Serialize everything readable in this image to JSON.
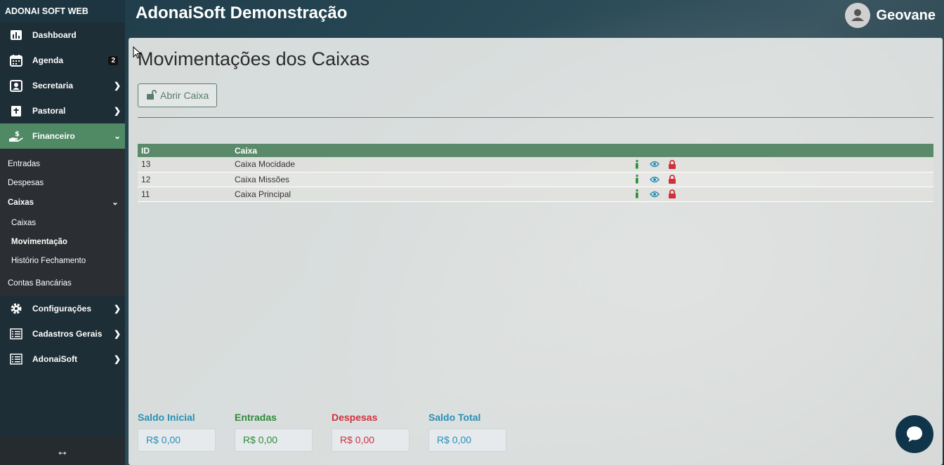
{
  "app": {
    "brand": "ADONAI SOFT WEB",
    "title": "AdonaiSoft Demonstração"
  },
  "user": {
    "name": "Geovane"
  },
  "sidebar": {
    "items": [
      {
        "label": "Dashboard",
        "icon": "bar-chart-icon"
      },
      {
        "label": "Agenda",
        "icon": "calendar-icon",
        "badge": "2"
      },
      {
        "label": "Secretaria",
        "icon": "id-card-icon"
      },
      {
        "label": "Pastoral",
        "icon": "bible-icon"
      },
      {
        "label": "Financeiro",
        "icon": "hand-money-icon"
      }
    ],
    "financeiro_sub": {
      "entradas": "Entradas",
      "despesas": "Despesas",
      "caixas": "Caixas",
      "caixas_sub": [
        "Caixas",
        "Movimentação",
        "Histório Fechamento"
      ],
      "contas": "Contas Bancárias"
    },
    "bottom_items": [
      {
        "label": "Configurações",
        "icon": "gear-icon"
      },
      {
        "label": "Cadastros Gerais",
        "icon": "list-icon"
      },
      {
        "label": "AdonaiSoft",
        "icon": "list-icon"
      }
    ],
    "footer_icon": "↔"
  },
  "main": {
    "title": "Movimentações dos Caixas",
    "open_button": "Abrir Caixa",
    "table": {
      "headers": [
        "ID",
        "Caixa"
      ],
      "rows": [
        {
          "id": "13",
          "caixa": "Caixa Mocidade"
        },
        {
          "id": "12",
          "caixa": "Caixa Missões"
        },
        {
          "id": "11",
          "caixa": "Caixa Principal"
        }
      ]
    },
    "totals": [
      {
        "label": "Saldo Inicial",
        "value": "R$ 0,00",
        "color": "#2a8fb5"
      },
      {
        "label": "Entradas",
        "value": "R$ 0,00",
        "color": "#2e8b3a"
      },
      {
        "label": "Despesas",
        "value": "R$ 0,00",
        "color": "#d12f3c"
      },
      {
        "label": "Saldo Total",
        "value": "R$ 0,00",
        "color": "#2a8fb5"
      }
    ]
  },
  "colors": {
    "accent": "#5b8a6b",
    "info": "#2e8b3a",
    "view": "#2a8fb5",
    "lock": "#d12f3c"
  }
}
